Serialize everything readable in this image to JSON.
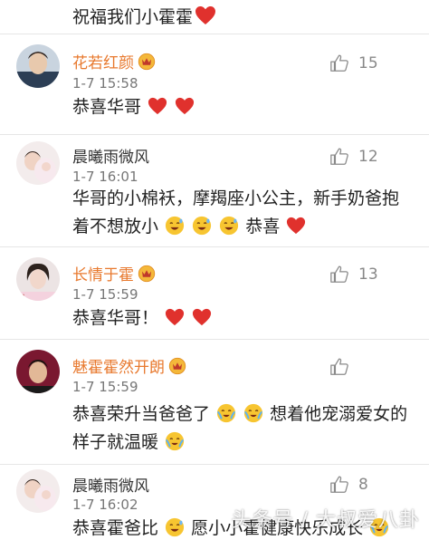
{
  "top_comment": {
    "text": "祝福我们小霍霍"
  },
  "comments": [
    {
      "username": "花若红颜",
      "time": "1-7 15:58",
      "likes": "15",
      "lines": [
        "恭喜华哥"
      ]
    },
    {
      "username": "晨曦雨微风",
      "time": "1-7 16:01",
      "likes": "12",
      "lines": [
        "华哥的小棉袄，摩羯座小公主，新手奶爸抱",
        "着不想放小",
        "恭喜"
      ]
    },
    {
      "username": "长情于霍",
      "time": "1-7 15:59",
      "likes": "13",
      "lines": [
        "恭喜华哥！"
      ]
    },
    {
      "username": "魅霍霍然开朗",
      "time": "1-7 15:59",
      "likes": "",
      "lines": [
        "恭喜荣升当爸爸了",
        "想着他宠溺爱女的",
        "样子就温暖"
      ]
    },
    {
      "username": "晨曦雨微风",
      "time": "1-7 16:02",
      "likes": "8",
      "lines": [
        "恭喜霍爸比",
        "愿小小霍健康快乐成长"
      ]
    }
  ],
  "watermark": "头条号 / 大叔爱八卦",
  "colors": {
    "heart": "#e0312d",
    "name_orange": "#e8792e",
    "meta_gray": "#888888",
    "divider": "#e6e6e6"
  },
  "icons": [
    "thumbs-up-icon",
    "heart-icon",
    "sweat-laugh-emoji",
    "crying-laugh-emoji",
    "vip-badge-icon"
  ]
}
